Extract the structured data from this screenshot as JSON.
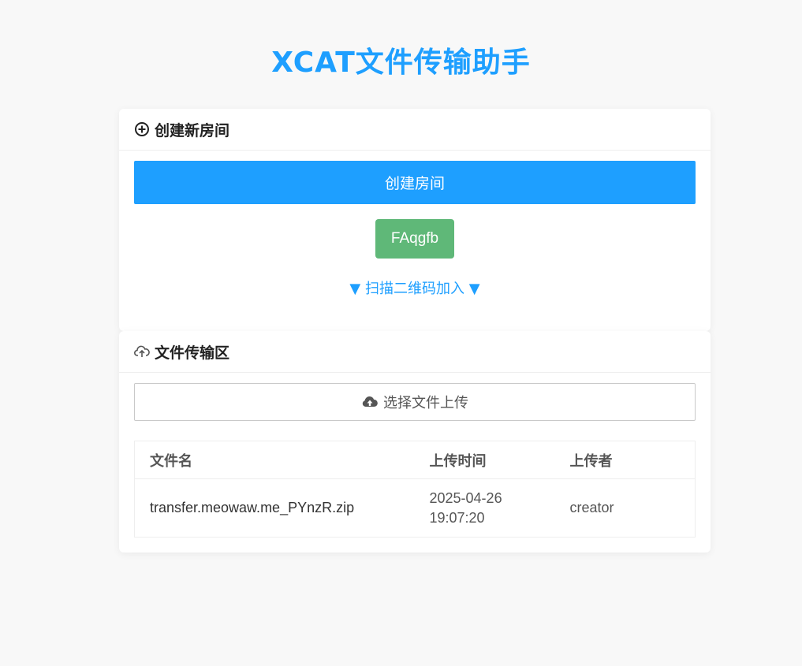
{
  "page": {
    "title": "XCAT文件传输助手"
  },
  "create_room": {
    "header": "创建新房间",
    "create_button": "创建房间",
    "room_code": "FAqgfb",
    "qr_toggle": "▼ 扫描二维码加入 ▼"
  },
  "transfer": {
    "header": "文件传输区",
    "upload_button": "选择文件上传",
    "table": {
      "columns": [
        "文件名",
        "上传时间",
        "上传者"
      ],
      "rows": [
        {
          "name": "transfer.meowaw.me_PYnzR.zip",
          "date": "2025-04-26",
          "time": "19:07:20",
          "uploader": "creator"
        }
      ]
    }
  },
  "colors": {
    "primary": "#1e9fff",
    "success": "#5fb878",
    "background": "#f8f8f8"
  },
  "icons": {
    "create_header": "plus-circle-icon",
    "transfer_header": "cloud-upload-outline-icon",
    "upload_button": "cloud-upload-icon"
  }
}
